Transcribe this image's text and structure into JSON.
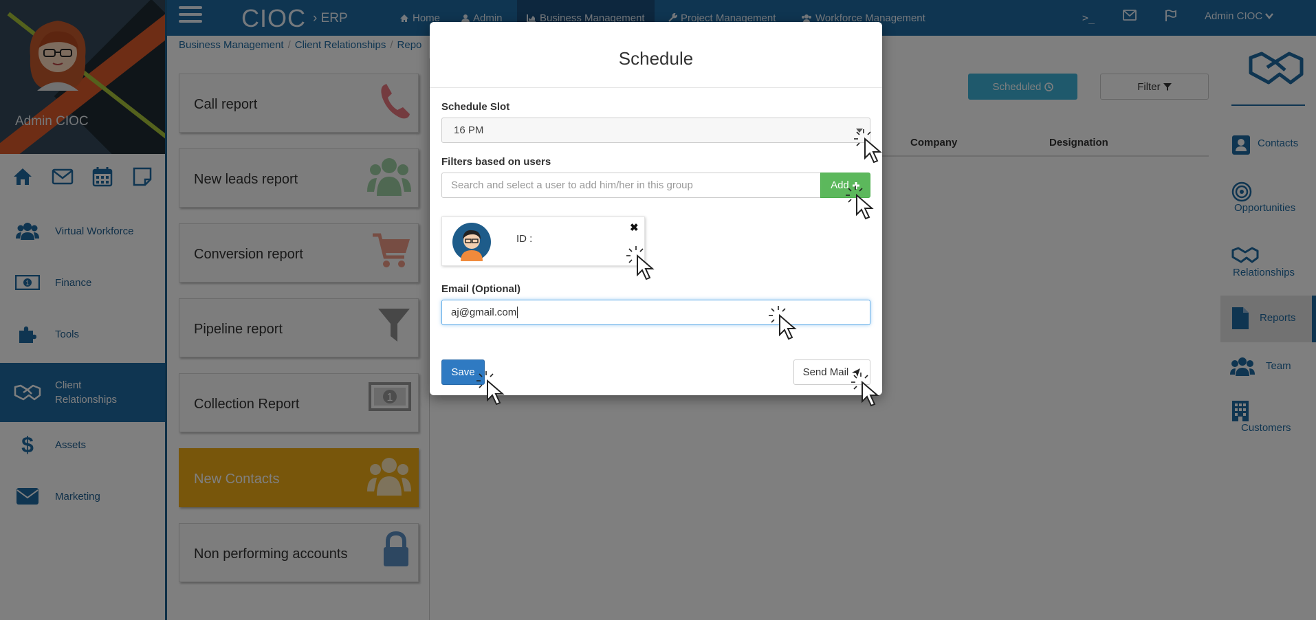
{
  "profile": {
    "name": "Admin CIOC"
  },
  "quick_icons": [
    "home-icon",
    "envelope-icon",
    "calendar-icon",
    "note-icon"
  ],
  "sidebar": {
    "items": [
      {
        "label": "Virtual Workforce",
        "icon": "users-icon"
      },
      {
        "label": "Finance",
        "icon": "money-icon"
      },
      {
        "label": "Tools",
        "icon": "puzzle-icon"
      },
      {
        "label": "Client Relationships",
        "icon": "handshake-icon",
        "active": true
      },
      {
        "label": "Assets",
        "icon": "dollar-icon"
      },
      {
        "label": "Marketing",
        "icon": "envelope-icon"
      }
    ]
  },
  "topnav": {
    "brand": "CIOC",
    "brand_sub": "› ERP",
    "links": [
      {
        "label": "Home",
        "icon": "home-icon"
      },
      {
        "label": "Admin",
        "icon": "user-icon"
      },
      {
        "label": "Business Management",
        "icon": "chart-icon",
        "active": true
      },
      {
        "label": "Project Management",
        "icon": "wrench-icon"
      },
      {
        "label": "Workforce Management",
        "icon": "users-icon"
      }
    ],
    "terminal": ">_",
    "user_menu": "Admin CIOC"
  },
  "breadcrumb": [
    "Business Management",
    "Client Relationships",
    "Repo"
  ],
  "cards": [
    {
      "label": "Call report",
      "icon": "phone-icon",
      "color": "#e8767e"
    },
    {
      "label": "New leads report",
      "icon": "users-icon",
      "color": "#9fd1a4"
    },
    {
      "label": "Conversion report",
      "icon": "cart-icon",
      "color": "#ee9a86"
    },
    {
      "label": "Pipeline report",
      "icon": "funnel-icon",
      "color": "#8f8f8f"
    },
    {
      "label": "Collection Report",
      "icon": "money-icon",
      "color": "#9a9a9a"
    },
    {
      "label": "New Contacts",
      "icon": "users-icon",
      "color": "#ffffff",
      "active": true
    },
    {
      "label": "Non performing accounts",
      "icon": "lock-icon",
      "color": "#5b8fc2"
    }
  ],
  "main": {
    "scheduled_label": "Scheduled",
    "filter_label": "Filter",
    "columns": [
      "Company",
      "Designation"
    ]
  },
  "right_sidebar": {
    "items": [
      {
        "label": "Contacts",
        "icon": "contact-icon"
      },
      {
        "label": "Opportunities",
        "icon": "target-icon"
      },
      {
        "label": "Relationships",
        "icon": "handshake-icon"
      },
      {
        "label": "Reports",
        "icon": "file-icon",
        "active": true
      },
      {
        "label": "Team",
        "icon": "users-icon"
      },
      {
        "label": "Customers",
        "icon": "building-icon"
      }
    ]
  },
  "modal": {
    "title": "Schedule",
    "slot_label": "Schedule Slot",
    "slot_value": "16 PM",
    "filters_label": "Filters based on users",
    "search_placeholder": "Search and select a user to add him/her in this group",
    "add_label": "Add",
    "user_id_label": "ID :",
    "close_glyph": "✖",
    "email_label": "Email (Optional)",
    "email_value": "aj@gmail.com",
    "save_label": "Save",
    "send_label": "Send Mail"
  },
  "colors": {
    "primary": "#1f6aa2",
    "success": "#5cb85c",
    "info": "#3fb3d8",
    "warning": "#f0ad16",
    "save": "#2f7ac2"
  }
}
